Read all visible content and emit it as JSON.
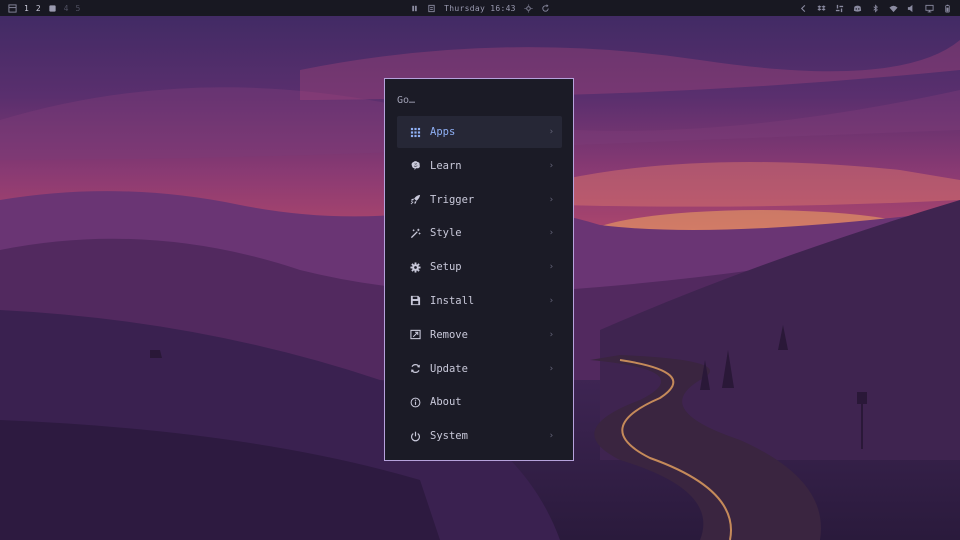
{
  "topbar": {
    "workspaces": [
      {
        "label": "1",
        "state": "active"
      },
      {
        "label": "2",
        "state": "active"
      },
      {
        "label": "4",
        "state": "dim"
      },
      {
        "label": "5",
        "state": "dim"
      }
    ],
    "clock": "Thursday 16:43",
    "tray_icons": [
      "chevron-left-icon",
      "dropbox-icon",
      "slack-icon",
      "discord-icon",
      "bluetooth-icon",
      "wifi-icon",
      "volume-icon",
      "display-icon",
      "battery-icon"
    ]
  },
  "launcher": {
    "prompt": "Go…",
    "items": [
      {
        "label": "Apps",
        "icon": "grid-icon",
        "submenu": true,
        "selected": true
      },
      {
        "label": "Learn",
        "icon": "brain-icon",
        "submenu": true,
        "selected": false
      },
      {
        "label": "Trigger",
        "icon": "rocket-icon",
        "submenu": true,
        "selected": false
      },
      {
        "label": "Style",
        "icon": "magic-wand-icon",
        "submenu": true,
        "selected": false
      },
      {
        "label": "Setup",
        "icon": "gear-icon",
        "submenu": true,
        "selected": false
      },
      {
        "label": "Install",
        "icon": "floppy-icon",
        "submenu": true,
        "selected": false
      },
      {
        "label": "Remove",
        "icon": "remove-box-icon",
        "submenu": true,
        "selected": false
      },
      {
        "label": "Update",
        "icon": "refresh-icon",
        "submenu": true,
        "selected": false
      },
      {
        "label": "About",
        "icon": "info-icon",
        "submenu": false,
        "selected": false
      },
      {
        "label": "System",
        "icon": "power-icon",
        "submenu": true,
        "selected": false
      }
    ],
    "chevron": "›"
  },
  "colors": {
    "topbar_bg": "#181822",
    "launcher_bg": "#1b1b26",
    "launcher_border": "#b6a2dc",
    "selected_bg": "#262736",
    "selected_text": "#8fb0f5",
    "text": "#c9c9da"
  }
}
